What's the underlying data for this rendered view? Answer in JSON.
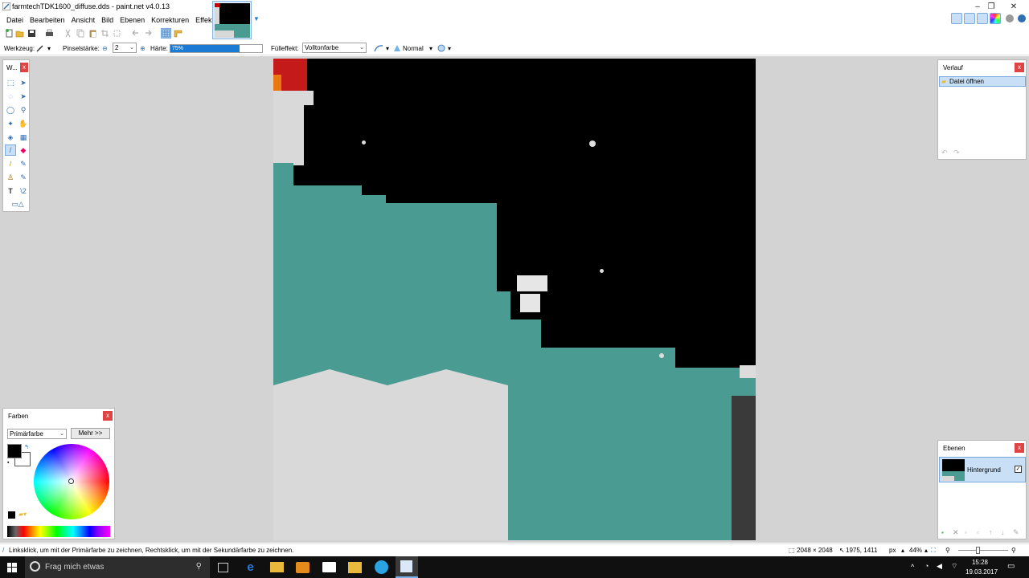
{
  "window": {
    "title": "farmtechTDK1600_diffuse.dds - paint.net v4.0.13",
    "minimize": "–",
    "maximize": "❐",
    "close": "✕"
  },
  "menu": [
    "Datei",
    "Bearbeiten",
    "Ansicht",
    "Bild",
    "Ebenen",
    "Korrekturen",
    "Effekte"
  ],
  "toolbar2": {
    "tool_label": "Werkzeug:",
    "brush_width_label": "Pinselstärke:",
    "brush_width_value": "2",
    "hardness_label": "Härte:",
    "hardness_value": "75%",
    "hardness_fraction": 0.75,
    "fill_label": "Fülleffekt:",
    "fill_value": "Volltonfarbe",
    "blend_mode": "Normal"
  },
  "tools_panel": {
    "title": "W..."
  },
  "history_panel": {
    "title": "Verlauf",
    "items": [
      "Datei öffnen"
    ]
  },
  "colors_panel": {
    "title": "Farben",
    "mode_select": "Primärfarbe",
    "more_button": "Mehr >>",
    "primary_color": "#000000",
    "secondary_color": "#ffffff"
  },
  "layers_panel": {
    "title": "Ebenen",
    "layers": [
      {
        "name": "Hintergrund",
        "visible": true
      }
    ]
  },
  "status": {
    "hint": "Linksklick, um mit der Primärfarbe zu zeichnen, Rechtsklick, um mit der Sekundärfarbe zu zeichnen.",
    "image_size": "2048 × 2048",
    "cursor_pos": "1975, 1411",
    "unit": "px",
    "zoom": "44%"
  },
  "taskbar": {
    "search_placeholder": "Frag mich etwas",
    "time": "15:28",
    "date": "19.03.2017"
  },
  "colors": {
    "teal": "#4a9b92",
    "light_gray": "#d9d9d9",
    "workspace": "#d3d3d3",
    "accent": "#1a7ad4",
    "close_red": "#e04343"
  }
}
